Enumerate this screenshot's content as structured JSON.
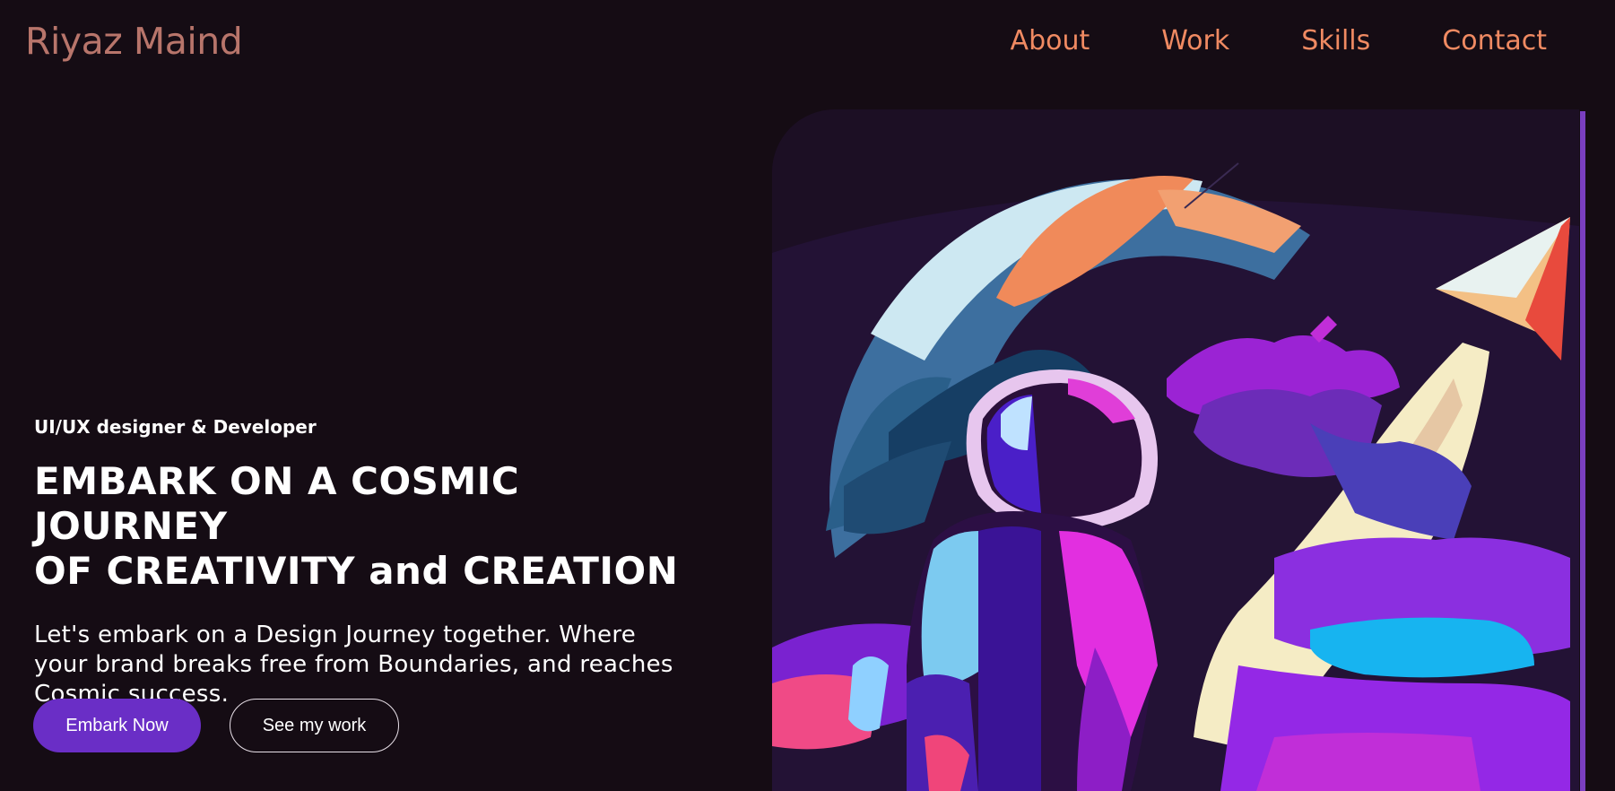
{
  "header": {
    "logo": "Riyaz Maind",
    "nav": [
      {
        "label": "About"
      },
      {
        "label": "Work"
      },
      {
        "label": "Skills"
      },
      {
        "label": "Contact"
      }
    ]
  },
  "hero": {
    "subtitle": "UI/UX designer & Developer",
    "headline_line1": "EMBARK ON A COSMIC JOURNEY",
    "headline_line2": "OF CREATIVITY and CREATION",
    "description_line1": "Let's embark on a Design Journey together. Where",
    "description_line2": "your brand breaks free from Boundaries, and reaches",
    "description_line3": "Cosmic success.",
    "primary_button": "Embark Now",
    "secondary_button": "See my work"
  },
  "artwork": {
    "icon": "astronaut-illustration",
    "colors": {
      "background": "#150c14",
      "accent": "#6a2ec6",
      "nav": "#f08a62",
      "logo": "#b8756b"
    }
  }
}
